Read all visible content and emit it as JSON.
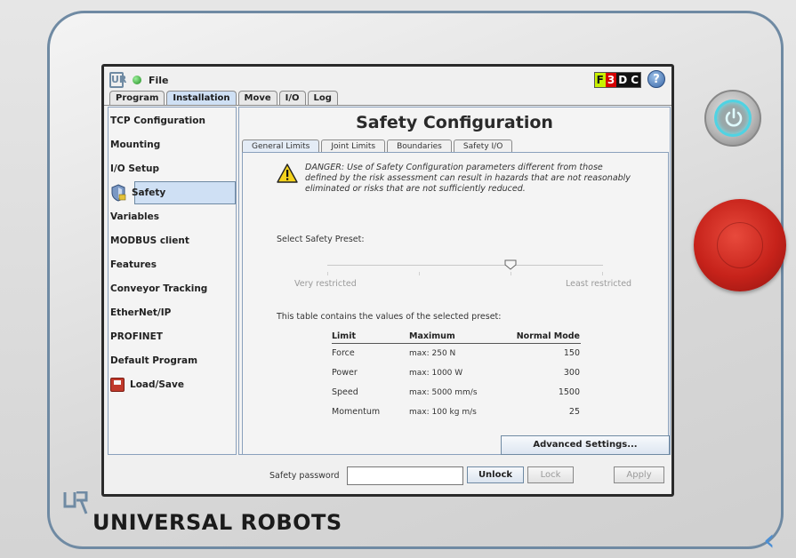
{
  "topbar": {
    "file_label": "File",
    "f3dc": [
      "F",
      "3",
      "D",
      "C"
    ],
    "help": "?"
  },
  "main_tabs": [
    "Program",
    "Installation",
    "Move",
    "I/O",
    "Log"
  ],
  "sidebar": {
    "items": [
      {
        "label": "TCP Configuration"
      },
      {
        "label": "Mounting"
      },
      {
        "label": "I/O Setup"
      },
      {
        "label": "Safety"
      },
      {
        "label": "Variables"
      },
      {
        "label": "MODBUS client"
      },
      {
        "label": "Features"
      },
      {
        "label": "Conveyor Tracking"
      },
      {
        "label": "EtherNet/IP"
      },
      {
        "label": "PROFINET"
      },
      {
        "label": "Default Program"
      },
      {
        "label": "Load/Save"
      }
    ],
    "selected": "Safety"
  },
  "content": {
    "title": "Safety Configuration",
    "sub_tabs": [
      "General Limits",
      "Joint Limits",
      "Boundaries",
      "Safety I/O"
    ],
    "danger_text": "DANGER: Use of Safety Configuration parameters different from those defined by the risk assessment can result in hazards that are not reasonably eliminated or risks that are not sufficiently reduced.",
    "preset_label": "Select Safety Preset:",
    "slider": {
      "low_label": "Very restricted",
      "high_label": "Least restricted",
      "position": 0.67
    },
    "table_note": "This table contains the values of the selected preset:",
    "table": {
      "headers": [
        "Limit",
        "Maximum",
        "Normal Mode"
      ],
      "rows": [
        [
          "Force",
          "max: 250 N",
          "150"
        ],
        [
          "Power",
          "max: 1000 W",
          "300"
        ],
        [
          "Speed",
          "max: 5000 mm/s",
          "1500"
        ],
        [
          "Momentum",
          "max: 100 kg m/s",
          "25"
        ]
      ]
    },
    "advanced_button": "Advanced Settings..."
  },
  "bottom": {
    "password_label": "Safety password",
    "password_value": "",
    "unlock": "Unlock",
    "lock": "Lock",
    "apply": "Apply"
  },
  "brand": "UNIVERSAL ROBOTS",
  "colors": {
    "accent": "#6f8aa3",
    "selected": "#cfe0f4",
    "estop": "#c6221a",
    "power_ring": "#4fd3e3"
  }
}
